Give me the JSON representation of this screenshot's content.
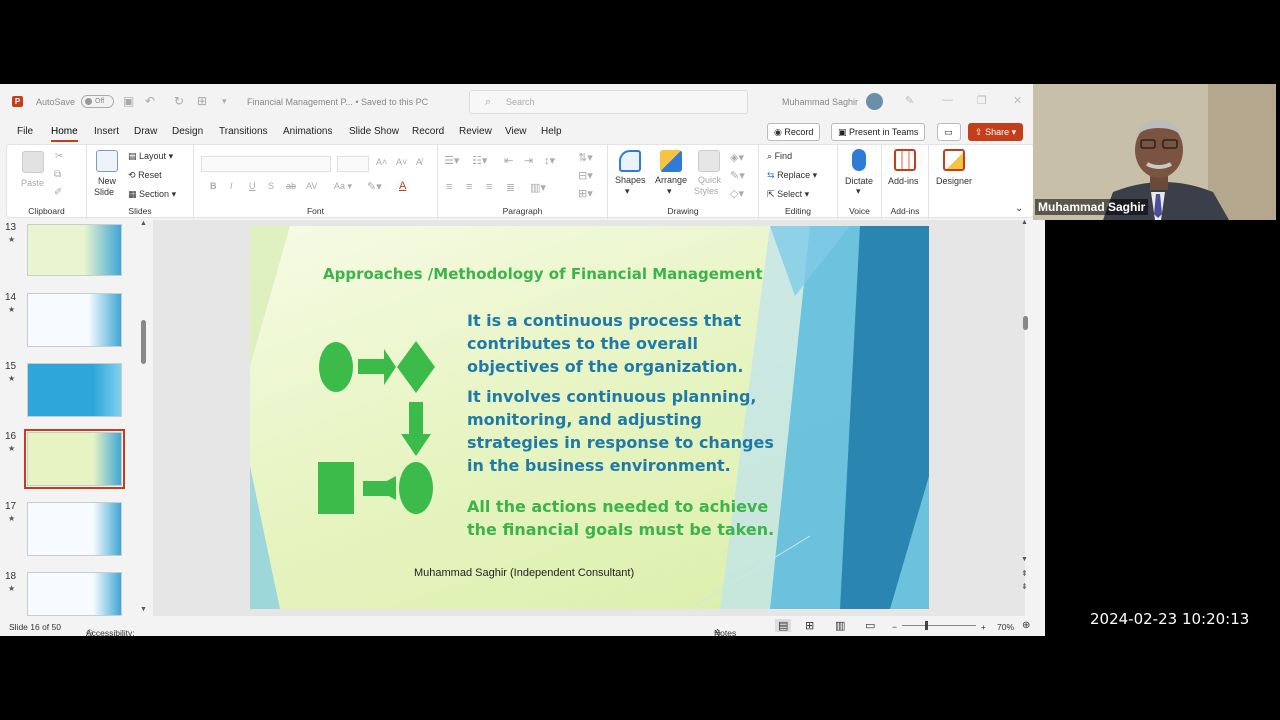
{
  "app": {
    "autosave_label": "AutoSave",
    "autosave_state": "Off",
    "document_title": "Financial Management P... • Saved to this PC",
    "search_placeholder": "Search",
    "user_name": "Muhammad Saghir"
  },
  "tabs": [
    "File",
    "Home",
    "Insert",
    "Draw",
    "Design",
    "Transitions",
    "Animations",
    "Slide Show",
    "Record",
    "Review",
    "View",
    "Help"
  ],
  "active_tab": "Home",
  "header_buttons": {
    "record": "Record",
    "present_in_teams": "Present in Teams",
    "share": "Share"
  },
  "ribbon": {
    "clipboard": {
      "label": "Clipboard",
      "paste": "Paste"
    },
    "slides": {
      "label": "Slides",
      "new_slide_1": "New",
      "new_slide_2": "Slide",
      "layout": "Layout",
      "reset": "Reset",
      "section": "Section"
    },
    "font": {
      "label": "Font"
    },
    "paragraph": {
      "label": "Paragraph"
    },
    "drawing": {
      "label": "Drawing",
      "shapes": "Shapes",
      "arrange": "Arrange",
      "quick_styles_1": "Quick",
      "quick_styles_2": "Styles"
    },
    "editing": {
      "label": "Editing",
      "find": "Find",
      "replace": "Replace",
      "select": "Select"
    },
    "voice": {
      "label": "Voice",
      "dictate": "Dictate"
    },
    "addins": {
      "label": "Add-ins",
      "addins": "Add-ins"
    },
    "designer": {
      "designer": "Designer"
    }
  },
  "thumbnails": [
    {
      "number": "13",
      "star": "★"
    },
    {
      "number": "14",
      "star": "★"
    },
    {
      "number": "15",
      "star": "★"
    },
    {
      "number": "16",
      "star": "★",
      "selected": true
    },
    {
      "number": "17",
      "star": "★"
    },
    {
      "number": "18",
      "star": "★"
    }
  ],
  "slide": {
    "title": "Approaches /Methodology of Financial Management",
    "para1": [
      "It is a continuous process that",
      "contributes to the overall",
      "objectives of the organization."
    ],
    "para2": [
      "It involves continuous planning,",
      "monitoring, and adjusting",
      "strategies in response to changes",
      "in the business environment."
    ],
    "para3": [
      "All the actions needed to achieve",
      "the financial goals must be taken."
    ],
    "credit": "Muhammad Saghir (Independent Consultant)"
  },
  "status": {
    "slide_count": "Slide 16 of 50",
    "accessibility": "Accessibility: Investigate",
    "notes": "Notes",
    "zoom": "70%"
  },
  "webcam": {
    "name": "Muhammad Saghir"
  },
  "timestamp": "2024-02-23 10:20:13",
  "colors": {
    "accent": "#c43e1c",
    "slide_green": "#3db34a",
    "slide_blue": "#1f7aa8"
  }
}
